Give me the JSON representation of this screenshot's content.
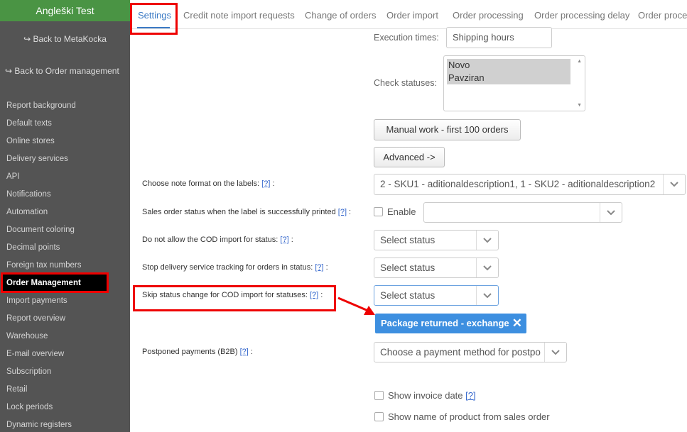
{
  "sidebar": {
    "title": "Angleški Test",
    "back_metakocka": "Back to MetaKocka",
    "back_order": "Back to Order management",
    "items": [
      {
        "label": "Report background"
      },
      {
        "label": "Default texts"
      },
      {
        "label": "Online stores"
      },
      {
        "label": "Delivery services"
      },
      {
        "label": "API"
      },
      {
        "label": "Notifications"
      },
      {
        "label": "Automation"
      },
      {
        "label": "Document coloring"
      },
      {
        "label": "Decimal points"
      },
      {
        "label": "Foreign tax numbers"
      },
      {
        "label": "Order Management"
      },
      {
        "label": "Import payments"
      },
      {
        "label": "Report overview"
      },
      {
        "label": "Warehouse"
      },
      {
        "label": "E-mail overview"
      },
      {
        "label": "Subscription"
      },
      {
        "label": "Retail"
      },
      {
        "label": "Lock periods"
      },
      {
        "label": "Dynamic registers"
      }
    ]
  },
  "tabs": [
    {
      "label": "Settings"
    },
    {
      "label": "Credit note import requests"
    },
    {
      "label": "Change of orders"
    },
    {
      "label": "Order import"
    },
    {
      "label": "Order processing"
    },
    {
      "label": "Order processing delay"
    },
    {
      "label": "Order proces"
    }
  ],
  "form": {
    "execution_label": "Execution times:",
    "execution_value": "Shipping hours",
    "check_statuses_label": "Check statuses:",
    "check_statuses_options": [
      "Novo",
      "Pavziran"
    ],
    "manual_work_btn": "Manual work - first 100 orders",
    "advanced_btn": "Advanced ->",
    "help": "[?]",
    "colon": " :",
    "note_format_label": "Choose note format on the labels:",
    "note_format_value": "2 - SKU1 - aditionaldescription1, 1 - SKU2 - aditionaldescription2",
    "sales_status_label": "Sales order status when the label is successfully printed",
    "enable_label": "Enable",
    "sales_status_value": "",
    "no_cod_label": "Do not allow the COD import for status:",
    "no_cod_value": "Select status",
    "stop_tracking_label": "Stop delivery service tracking for orders in status:",
    "stop_tracking_value": "Select status",
    "skip_status_label": "Skip status change for COD import for statuses:",
    "skip_status_value": "Select status",
    "skip_status_tag": "Package returned - exchange",
    "postponed_label": "Postponed payments (B2B)",
    "postponed_value": "Choose a payment method for postpon",
    "show_invoice_date": "Show invoice date",
    "show_product_name": "Show name of product from sales order"
  },
  "colors": {
    "active_nav_bg": "#000000",
    "title_bg": "#4a9444",
    "accent": "#3b7ac5",
    "tag_bg": "#3d8fe0",
    "highlight": "#e00000"
  }
}
